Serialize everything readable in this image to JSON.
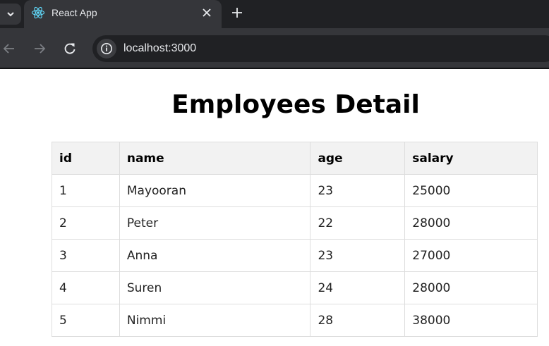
{
  "browser": {
    "tab": {
      "title": "React App",
      "favicon": "react-logo-icon"
    },
    "url": "localhost:3000"
  },
  "page": {
    "title": "Employees Detail",
    "table": {
      "headers": [
        "id",
        "name",
        "age",
        "salary"
      ],
      "rows": [
        [
          "1",
          "Mayooran",
          "23",
          "25000"
        ],
        [
          "2",
          "Peter",
          "22",
          "28000"
        ],
        [
          "3",
          "Anna",
          "23",
          "27000"
        ],
        [
          "4",
          "Suren",
          "24",
          "28000"
        ],
        [
          "5",
          "Nimmi",
          "28",
          "38000"
        ]
      ]
    }
  }
}
